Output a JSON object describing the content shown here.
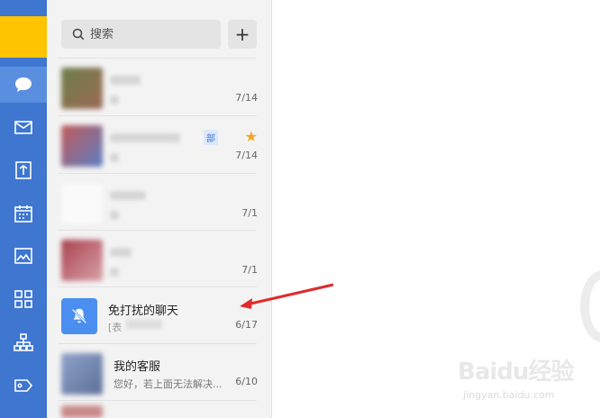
{
  "sidebar": {
    "items": [
      {
        "name": "chat",
        "icon": "chat-bubble-icon"
      },
      {
        "name": "mail",
        "icon": "mail-icon"
      },
      {
        "name": "docs",
        "icon": "document-icon"
      },
      {
        "name": "calendar",
        "icon": "calendar-icon"
      },
      {
        "name": "workbench",
        "icon": "image-icon"
      },
      {
        "name": "apps",
        "icon": "apps-grid-icon"
      },
      {
        "name": "contacts",
        "icon": "org-chart-icon"
      },
      {
        "name": "tags",
        "icon": "tag-icon"
      }
    ],
    "accent": "#3e76d0",
    "avatar_color": "#ffc300"
  },
  "search": {
    "placeholder": "搜索",
    "add_label": "+"
  },
  "chats": [
    {
      "date": "7/14"
    },
    {
      "date": "7/14",
      "starred": true,
      "tag": "部"
    },
    {
      "date": "7/1"
    },
    {
      "date": "7/1"
    },
    {
      "title": "免打扰的聊天",
      "preview_prefix": "[表",
      "date": "6/17",
      "icon": "bell-off-icon"
    },
    {
      "title": "我的客服",
      "preview": "您好，若上面无法解决...",
      "date": "6/10"
    }
  ],
  "watermark": {
    "logo": "Baidu经验",
    "url": "jingyan.baidu.com"
  }
}
